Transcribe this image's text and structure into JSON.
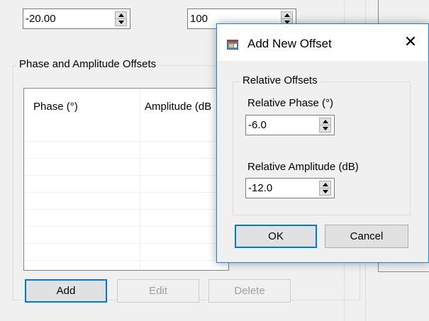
{
  "background": {
    "top_spinner_1_value": "-20.00",
    "top_spinner_2_value": "100",
    "offsets_group_label": "Phase and Amplitude Offsets",
    "list_columns": [
      "Phase (°)",
      "Amplitude (dB"
    ],
    "add_label": "Add",
    "edit_label": "Edit",
    "delete_label": "Delete"
  },
  "dialog": {
    "title": "Add New Offset",
    "close_glyph": "✕",
    "group_label": "Relative Offsets",
    "phase_label": "Relative Phase (°)",
    "phase_value": "-6.0",
    "amplitude_label": "Relative Amplitude (dB)",
    "amplitude_value": "-12.0",
    "ok_label": "OK",
    "cancel_label": "Cancel"
  },
  "colors": {
    "window_bg": "#f0f0f0",
    "accent_blue": "#0078d7",
    "border_gray": "#adadad"
  }
}
